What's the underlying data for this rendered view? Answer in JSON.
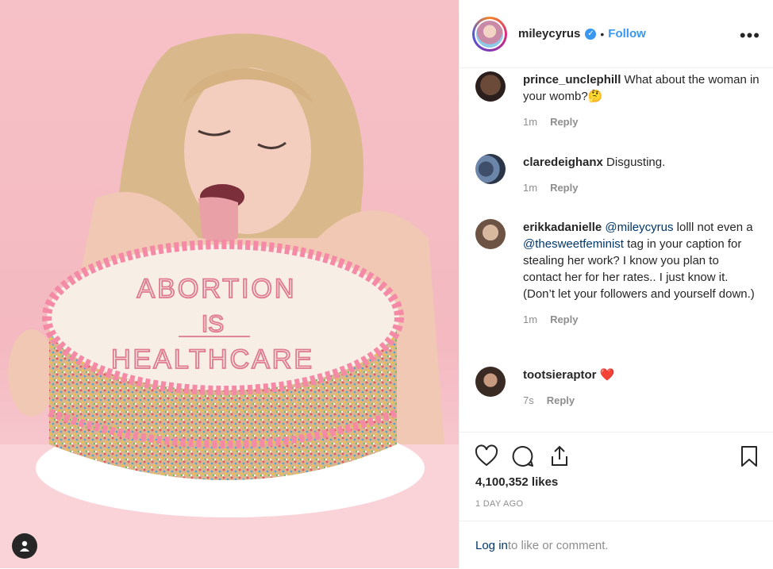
{
  "post": {
    "username": "mileycyrus",
    "separator": "•",
    "follow_label": "Follow",
    "more_label": "•••",
    "cake_line1": "ABORTION",
    "cake_line2": "IS",
    "cake_line3": "HEALTHCARE"
  },
  "comments": [
    {
      "user": "prince_unclephill",
      "pre": " What about the woman in your womb?🤔",
      "mention1": "",
      "mid": "",
      "mention2": "",
      "post": "",
      "time": "1m",
      "reply": "Reply"
    },
    {
      "user": "claredeighanx",
      "pre": " Disgusting.",
      "mention1": "",
      "mid": "",
      "mention2": "",
      "post": "",
      "time": "1m",
      "reply": "Reply"
    },
    {
      "user": "erikkadanielle",
      "pre": " ",
      "mention1": "@mileycyrus",
      "mid": " lolll not even a ",
      "mention2": "@thesweetfeminist",
      "post": " tag in your caption for stealing her work? I know you plan to contact her for her rates.. I just know it. (Don’t let your followers and yourself down.)",
      "time": "1m",
      "reply": "Reply"
    },
    {
      "user": "tootsieraptor",
      "pre": " ❤️",
      "mention1": "",
      "mid": "",
      "mention2": "",
      "post": "",
      "time": "7s",
      "reply": "Reply"
    }
  ],
  "actions": {
    "icons": [
      "heart-icon",
      "comment-icon",
      "share-icon",
      "bookmark-icon"
    ],
    "likes": "4,100,352 likes",
    "time_ago": "1 DAY AGO"
  },
  "login": {
    "link": "Log in",
    "text": " to like or comment."
  },
  "colors": {
    "accent": "#3897f0",
    "background_pink": "#f6c1c7",
    "text": "#262626",
    "muted": "#8e8e8e"
  }
}
